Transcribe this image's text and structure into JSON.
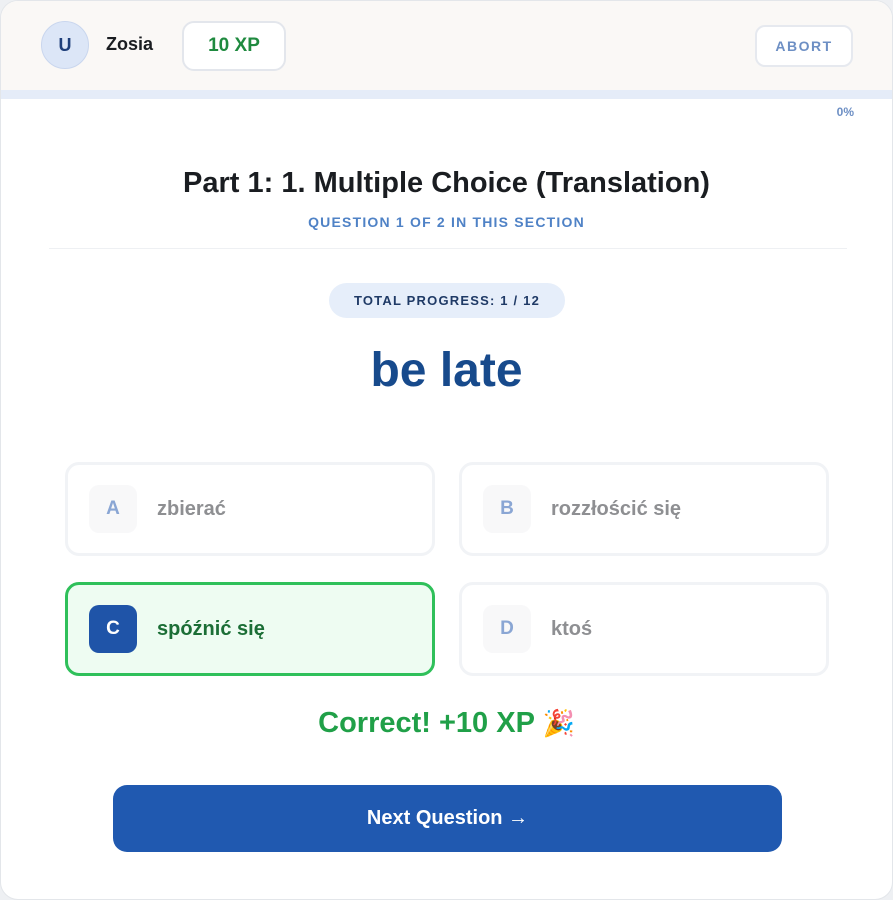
{
  "header": {
    "avatar_initial": "U",
    "username": "Zosia",
    "xp": "10 XP",
    "abort_label": "ABORT"
  },
  "progress": {
    "percent_label": "0%",
    "fraction": 0.0
  },
  "section": {
    "title": "Part 1: 1. Multiple Choice (Translation)",
    "subtitle": "QUESTION 1 OF 2 IN THIS SECTION"
  },
  "total_progress": "TOTAL PROGRESS: 1 / 12",
  "prompt_word": "be late",
  "options": [
    {
      "letter": "A",
      "text": "zbierać",
      "state": "default"
    },
    {
      "letter": "B",
      "text": "rozzłościć się",
      "state": "default"
    },
    {
      "letter": "C",
      "text": "spóźnić się",
      "state": "correct"
    },
    {
      "letter": "D",
      "text": "ktoś",
      "state": "default"
    }
  ],
  "feedback": {
    "text": "Correct! +10 XP",
    "emoji": "🎉"
  },
  "next_button_label": "Next Question →",
  "colors": {
    "accent": "#2059b0",
    "correct": "#2fc05a",
    "xp_green": "#1f8a3f"
  }
}
